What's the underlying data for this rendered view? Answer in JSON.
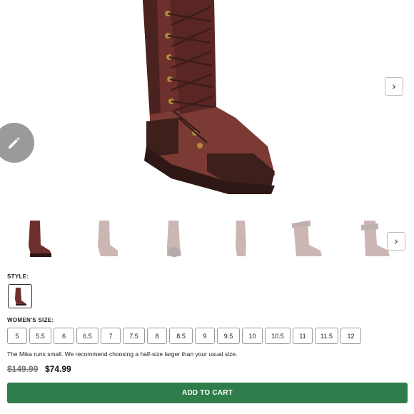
{
  "gallery": {
    "main_image_alt": "Mika boot",
    "next_icon": "chevron-right-icon",
    "edit_icon": "pencil-icon",
    "thumbnails": [
      {
        "name": "thumb-side-brown",
        "active": true
      },
      {
        "name": "thumb-2",
        "active": false
      },
      {
        "name": "thumb-3",
        "active": false
      },
      {
        "name": "thumb-4",
        "active": false
      },
      {
        "name": "thumb-5",
        "active": false
      },
      {
        "name": "thumb-6",
        "active": false
      }
    ]
  },
  "style": {
    "label": "STYLE:"
  },
  "size": {
    "label": "WOMEN'S SIZE:",
    "options": [
      "5",
      "5.5",
      "6",
      "6.5",
      "7",
      "7.5",
      "8",
      "8.5",
      "9",
      "9.5",
      "10",
      "10.5",
      "11",
      "11.5",
      "12"
    ]
  },
  "fit_note": "The Mika runs small. We recommend choosing a half-size larger than your usual size.",
  "pricing": {
    "original": "$149.99",
    "sale": "$74.99"
  },
  "cart": {
    "label": "ADD TO CART"
  },
  "colors": {
    "boot": "#6b2f2c",
    "boot_dark": "#3e1f1c",
    "accent_green": "#2e7d4a"
  }
}
